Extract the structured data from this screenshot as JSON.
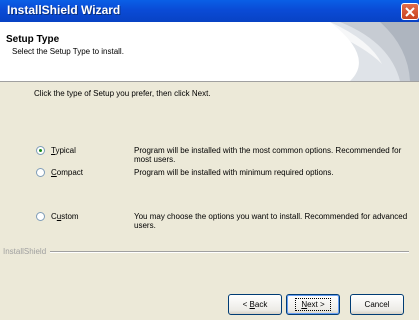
{
  "window": {
    "title": "InstallShield Wizard"
  },
  "header": {
    "title": "Setup Type",
    "subtitle": "Select the Setup Type to install."
  },
  "main": {
    "instruction": "Click the type of Setup you prefer, then click Next.",
    "options": [
      {
        "label_pre": "",
        "label_underlined": "T",
        "label_post": "ypical",
        "description": "Program will be installed with the most common options.  Recommended for most users.",
        "selected": true
      },
      {
        "label_pre": "",
        "label_underlined": "C",
        "label_post": "ompact",
        "description": "Program will be installed with minimum required options.",
        "selected": false
      },
      {
        "label_pre": "C",
        "label_underlined": "u",
        "label_post": "stom",
        "description": "You may choose the options you want to install. Recommended for advanced users.",
        "selected": false
      }
    ]
  },
  "footer": {
    "brand": "InstallShield",
    "back": {
      "pre": "< ",
      "u": "B",
      "post": "ack"
    },
    "next": {
      "u": "N",
      "post": "ext >"
    },
    "cancel": "Cancel"
  },
  "colors": {
    "titlebar": "#0a4bd6",
    "dialog_bg": "#ece9d8",
    "radio_dot": "#1a8a1a"
  },
  "icons": {
    "close": "close-icon",
    "header_art": "installer-graphic"
  }
}
